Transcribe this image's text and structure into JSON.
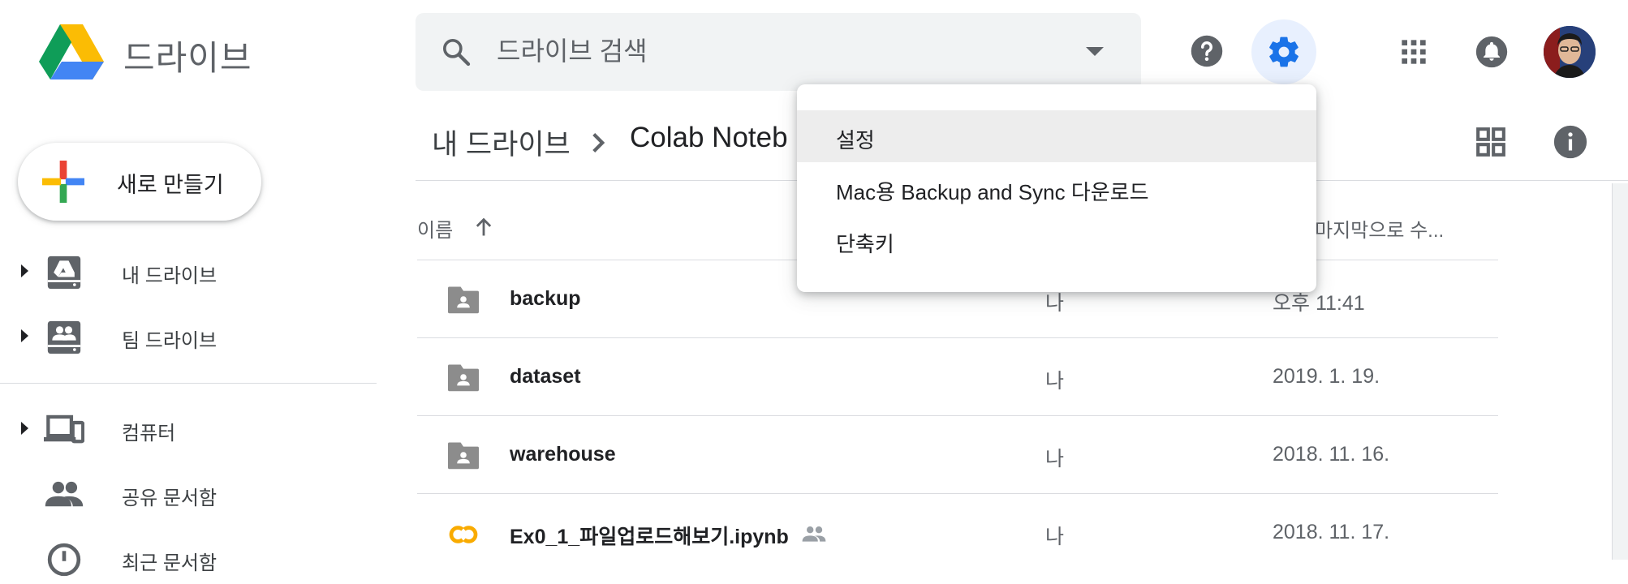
{
  "header": {
    "app_title": "드라이브",
    "search_placeholder": "드라이브 검색",
    "icons": [
      "search-icon",
      "help-icon",
      "settings-icon",
      "apps-grid-icon",
      "notifications-icon"
    ]
  },
  "sidebar": {
    "new_button": "새로 만들기",
    "items": [
      {
        "label": "내 드라이브",
        "icon": "my-drive-icon"
      },
      {
        "label": "팀 드라이브",
        "icon": "team-drive-icon"
      },
      {
        "label": "컴퓨터",
        "icon": "computers-icon"
      },
      {
        "label": "공유 문서함",
        "icon": "shared-icon"
      },
      {
        "label": "최근 문서함",
        "icon": "recent-icon"
      }
    ]
  },
  "breadcrumb": {
    "root": "내 드라이브",
    "current": "Colab Noteb"
  },
  "list": {
    "col_name": "이름",
    "col_modified": "마지막으로 수...",
    "rows": [
      {
        "name": "backup",
        "owner": "나",
        "modified": "오후 11:41",
        "type": "shared-folder"
      },
      {
        "name": "dataset",
        "owner": "나",
        "modified": "2019. 1. 19.",
        "type": "shared-folder"
      },
      {
        "name": "warehouse",
        "owner": "나",
        "modified": "2018. 11. 16.",
        "type": "shared-folder"
      },
      {
        "name": "Ex0_1_파일업로드해보기.ipynb",
        "owner": "나",
        "modified": "2018. 11. 17.",
        "type": "colab-notebook",
        "shared": true
      }
    ]
  },
  "settings_menu": {
    "items": [
      {
        "label": "설정"
      },
      {
        "label": "Mac용 Backup and Sync 다운로드"
      },
      {
        "label": "단축키"
      }
    ]
  },
  "colors": {
    "accent": "#1a73e8",
    "settings_highlight": "#e8f0fe",
    "icon_gray": "#5f6368",
    "colab_orange": "#f9ab00"
  }
}
